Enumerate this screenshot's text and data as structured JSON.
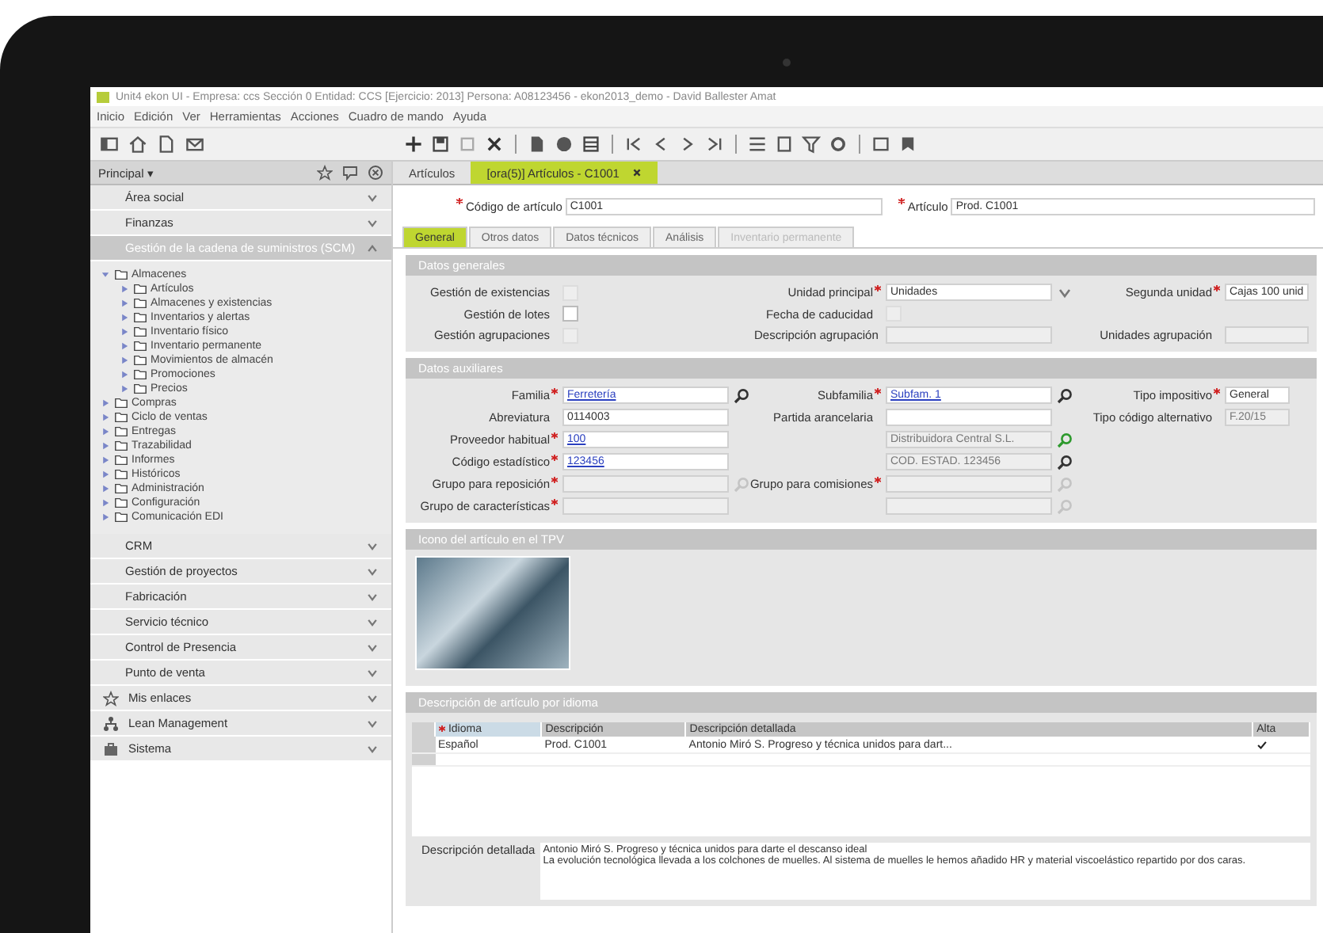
{
  "window": {
    "title": "Unit4 ekon UI - Empresa: ccs Sección 0 Entidad: CCS [Ejercicio: 2013] Persona: A08123456 - ekon2013_demo - David Ballester Amat"
  },
  "menu": [
    "Inicio",
    "Edición",
    "Ver",
    "Herramientas",
    "Acciones",
    "Cuadro de mando",
    "Ayuda"
  ],
  "sidebar": {
    "title": "Principal ▾",
    "sections": [
      {
        "label": "Área social",
        "kind": "module",
        "expanded": false
      },
      {
        "label": "Finanzas",
        "kind": "module",
        "expanded": false
      },
      {
        "label": "Gestión de la cadena de suministros (SCM)",
        "kind": "module",
        "expanded": true,
        "children": [
          {
            "label": "Almacenes",
            "expanded": true,
            "children": [
              {
                "label": "Artículos",
                "expanded": false
              },
              {
                "label": "Almacenes y existencias",
                "expanded": false
              },
              {
                "label": "Inventarios y alertas",
                "expanded": false
              },
              {
                "label": "Inventario físico",
                "expanded": false
              },
              {
                "label": "Inventario permanente",
                "expanded": false
              },
              {
                "label": "Movimientos de almacén",
                "expanded": false
              },
              {
                "label": "Promociones",
                "expanded": false
              },
              {
                "label": "Precios",
                "expanded": false
              }
            ]
          },
          {
            "label": "Compras",
            "expanded": false
          },
          {
            "label": "Ciclo de ventas",
            "expanded": false
          },
          {
            "label": "Entregas",
            "expanded": false
          },
          {
            "label": "Trazabilidad",
            "expanded": false
          },
          {
            "label": "Informes",
            "expanded": false
          },
          {
            "label": "Históricos",
            "expanded": false
          },
          {
            "label": "Administración",
            "expanded": false
          },
          {
            "label": "Configuración",
            "expanded": false
          },
          {
            "label": "Comunicación EDI",
            "expanded": false
          }
        ]
      },
      {
        "label": "CRM",
        "kind": "module",
        "expanded": false
      },
      {
        "label": "Gestión de proyectos",
        "kind": "module",
        "expanded": false
      },
      {
        "label": "Fabricación",
        "kind": "module",
        "expanded": false
      },
      {
        "label": "Servicio técnico",
        "kind": "module",
        "expanded": false
      },
      {
        "label": "Control de Presencia",
        "kind": "module",
        "expanded": false
      },
      {
        "label": "Punto de venta",
        "kind": "module",
        "expanded": false
      },
      {
        "label": "Mis enlaces",
        "kind": "favorites",
        "expanded": false
      },
      {
        "label": "Lean Management",
        "kind": "lean",
        "expanded": false
      },
      {
        "label": "Sistema",
        "kind": "system",
        "expanded": false
      }
    ]
  },
  "doc_tabs": [
    {
      "label": "Artículos",
      "selected": false,
      "closable": false
    },
    {
      "label": "[ora(5)] Artículos - C1001",
      "selected": true,
      "closable": true
    }
  ],
  "header_fields": [
    {
      "label": "Código de artículo",
      "required": true,
      "value": "C1001"
    },
    {
      "label": "Artículo",
      "required": true,
      "value": "Prod. C1001"
    }
  ],
  "form_tabs": [
    {
      "label": "General",
      "selected": true,
      "disabled": false
    },
    {
      "label": "Otros datos",
      "selected": false,
      "disabled": false
    },
    {
      "label": "Datos técnicos",
      "selected": false,
      "disabled": false
    },
    {
      "label": "Análisis",
      "selected": false,
      "disabled": false
    },
    {
      "label": "Inventario permanente",
      "selected": false,
      "disabled": true
    }
  ],
  "sections": [
    {
      "title": "Datos generales",
      "kind": "form",
      "rows": [
        {
          "left": {
            "label": "Gestión de existencias",
            "kind": "check",
            "checked": false,
            "disabled": true
          },
          "middle": {
            "label": "Unidad principal",
            "kind": "select",
            "required": true,
            "value": "Unidades"
          },
          "right": {
            "label": "Segunda unidad",
            "kind": "text",
            "required": true,
            "value": "Cajas 100 unid"
          }
        },
        {
          "left": {
            "label": "Gestión de lotes",
            "kind": "check",
            "checked": false,
            "disabled": false
          },
          "middle": {
            "label": "Fecha de caducidad",
            "kind": "check",
            "checked": false,
            "disabled": true
          }
        },
        {
          "left": {
            "label": "Gestión agrupaciones",
            "kind": "check",
            "checked": false,
            "disabled": true
          },
          "middle": {
            "label": "Descripción agrupación",
            "kind": "text",
            "disabled": true
          },
          "right": {
            "label": "Unidades agrupación",
            "kind": "text",
            "disabled": true
          }
        }
      ]
    },
    {
      "title": "Datos auxiliares",
      "kind": "form",
      "rows": [
        {
          "left": {
            "label": "Familia",
            "kind": "text",
            "required": true,
            "value": "Ferretería",
            "link": true,
            "search": true
          },
          "middle": {
            "label": "Subfamilia",
            "kind": "text",
            "required": true,
            "value": "Subfam. 1",
            "link": true,
            "search": true
          },
          "right": {
            "label": "Tipo impositivo",
            "kind": "text",
            "required": true,
            "value": "General"
          }
        },
        {
          "left": {
            "label": "Abreviatura",
            "kind": "text",
            "value": "0114003"
          },
          "middle": {
            "label": "Partida arancelaria",
            "kind": "text"
          },
          "right": {
            "label": "Tipo código alternativo",
            "kind": "text",
            "value": "F.20/15",
            "disabled": true
          }
        },
        {
          "left": {
            "label": "Proveedor habitual",
            "kind": "text",
            "required": true,
            "value": "100",
            "link": true
          },
          "middle": {
            "kind": "text",
            "value": "Distribuidora Central S.L.",
            "disabled": true,
            "search": true,
            "search_highlight": true
          }
        },
        {
          "left": {
            "label": "Código estadístico",
            "kind": "text",
            "required": true,
            "value": "123456",
            "link": true
          },
          "middle": {
            "kind": "text",
            "value": "COD. ESTAD. 123456",
            "disabled": true,
            "search": true
          }
        },
        {
          "left": {
            "label": "Grupo para reposición",
            "kind": "text",
            "required": true,
            "disabled": true,
            "search": true,
            "search_disabled": true
          },
          "middle": {
            "label": "Grupo para comisiones",
            "kind": "text",
            "required": true,
            "disabled": true,
            "search": true,
            "search_disabled": true
          }
        },
        {
          "left": {
            "label": "Grupo de características",
            "kind": "text",
            "required": true,
            "disabled": true
          },
          "middle": {
            "kind": "text",
            "disabled": true,
            "search": true,
            "search_disabled": true
          }
        }
      ]
    },
    {
      "title": "Icono del artículo en el TPV",
      "kind": "image"
    },
    {
      "title": "Descripción de artículo por idioma",
      "kind": "table",
      "columns": [
        {
          "label": "Idioma",
          "required": true
        },
        {
          "label": "Descripción",
          "required": false
        },
        {
          "label": "Descripción detallada",
          "required": false
        },
        {
          "label": "Alta",
          "required": false
        }
      ],
      "rows": [
        {
          "cells": [
            "Español",
            "Prod. C1001",
            "Antonio Miró S. Progreso y técnica unidos para dart..."
          ],
          "checked": true,
          "selected": false
        }
      ],
      "detail": {
        "label": "Descripción detallada",
        "lines": [
          "Antonio Miró S. Progreso y técnica unidos para darte el descanso ideal",
          "La evolución tecnológica llevada a los colchones de muelles. Al sistema de muelles le hemos añadido HR y material viscoelástico repartido por dos caras."
        ]
      }
    }
  ]
}
